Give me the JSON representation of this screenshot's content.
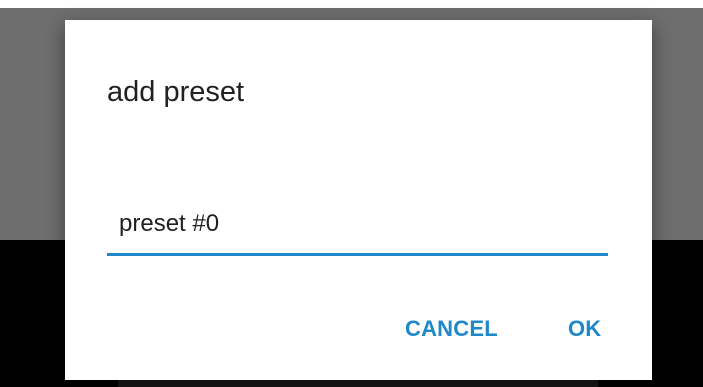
{
  "dialog": {
    "title": "add preset",
    "input": {
      "value": "preset #0"
    },
    "buttons": {
      "cancel_label": "CANCEL",
      "ok_label": "OK"
    }
  },
  "colors": {
    "accent": "#1e88c9",
    "backdrop_gray": "#6e6e6e",
    "backdrop_black": "#000000",
    "dialog_bg": "#ffffff",
    "text": "#212121"
  }
}
